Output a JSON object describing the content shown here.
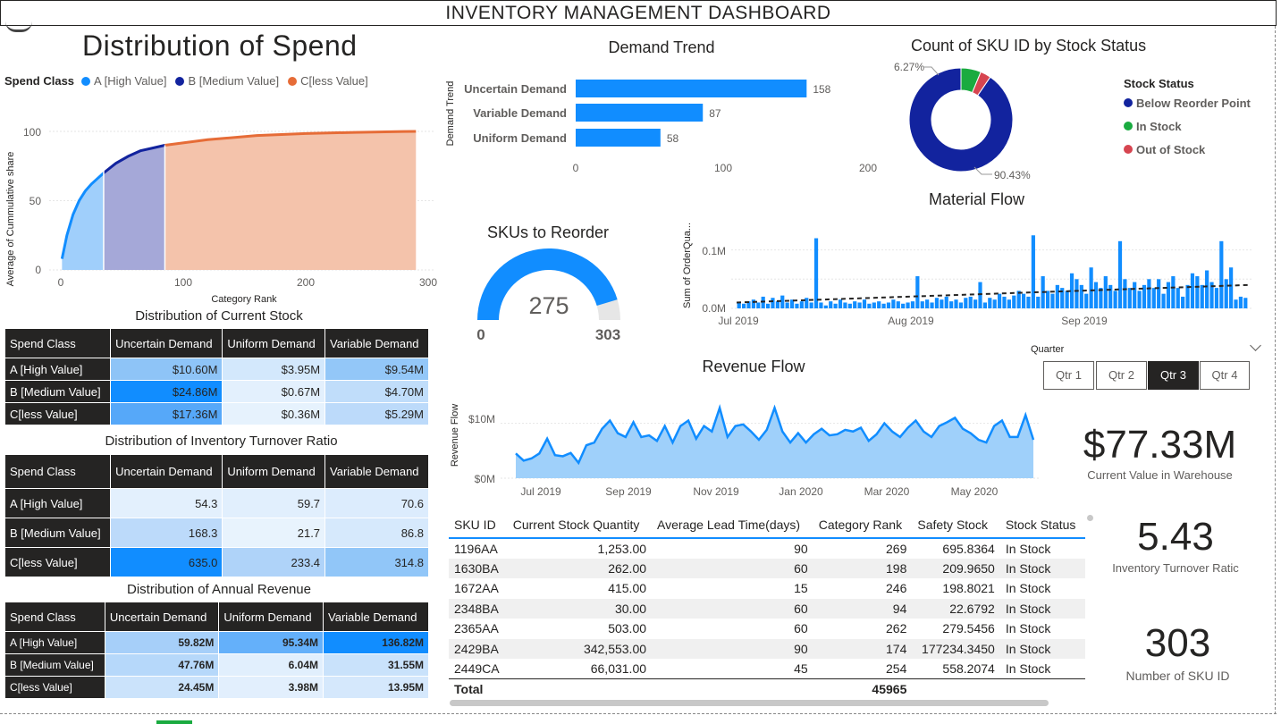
{
  "dashboard_title": "INVENTORY MANAGEMENT DASHBOARD",
  "colors": {
    "blue": "#118dff",
    "dark_navy": "#12239e",
    "orange": "#e66c37",
    "green": "#1aab40",
    "red": "#d64550",
    "dark": "#252423"
  },
  "spend_chart": {
    "title": "Distribution of Spend",
    "legend_title": "Spend Class",
    "legend": [
      {
        "label": "A [High Value]",
        "color": "#118dff"
      },
      {
        "label": "B [Medium Value]",
        "color": "#12239e"
      },
      {
        "label": "C[less Value]",
        "color": "#e66c37"
      }
    ],
    "xlabel": "Category Rank",
    "ylabel": "Average of Cummulative share",
    "x_ticks": [
      "0",
      "100",
      "200",
      "300"
    ],
    "y_ticks": [
      "0",
      "50",
      "100"
    ]
  },
  "current_stock": {
    "title": "Distribution of Current Stock",
    "headers": [
      "Spend Class",
      "Uncertain Demand",
      "Uniform Demand",
      "Variable Demand"
    ],
    "rows": [
      {
        "label": "A [High Value]",
        "cells": [
          "$10.60M",
          "$3.95M",
          "$9.54M"
        ]
      },
      {
        "label": "B [Medium Value]",
        "cells": [
          "$24.86M",
          "$0.67M",
          "$4.70M"
        ]
      },
      {
        "label": "C[less Value]",
        "cells": [
          "$17.36M",
          "$0.36M",
          "$5.29M"
        ]
      }
    ]
  },
  "turnover": {
    "title": "Distribution of Inventory Turnover Ratio",
    "headers": [
      "Spend Class",
      "Uncertain Demand",
      "Uniform Demand",
      "Variable Demand"
    ],
    "rows": [
      {
        "label": "A [High Value]",
        "cells": [
          "54.3",
          "59.7",
          "70.6"
        ]
      },
      {
        "label": "B [Medium Value]",
        "cells": [
          "168.3",
          "21.7",
          "86.8"
        ]
      },
      {
        "label": "C[less Value]",
        "cells": [
          "635.0",
          "233.4",
          "314.8"
        ]
      }
    ]
  },
  "annual_revenue": {
    "title": "Distribution of Annual Revenue",
    "headers": [
      "Spend Class",
      "Uncertain Demand",
      "Uniform Demand",
      "Variable Demand"
    ],
    "rows": [
      {
        "label": "A [High Value]",
        "cells": [
          "59.82M",
          "95.34M",
          "136.82M"
        ]
      },
      {
        "label": "B [Medium Value]",
        "cells": [
          "47.76M",
          "6.04M",
          "31.55M"
        ]
      },
      {
        "label": "C[less Value]",
        "cells": [
          "24.45M",
          "3.98M",
          "13.95M"
        ]
      }
    ]
  },
  "demand_trend": {
    "title": "Demand Trend",
    "ylabel": "Demand Trend",
    "x_ticks": [
      "0",
      "100",
      "200"
    ]
  },
  "stock_status": {
    "title": "Count of SKU ID by Stock Status",
    "legend_title": "Stock Status",
    "labels_pct": [
      "6.27%",
      "90.43%"
    ],
    "legend": [
      {
        "label": "Below Reorder Point",
        "color": "#12239e"
      },
      {
        "label": "In Stock",
        "color": "#1aab40"
      },
      {
        "label": "Out of Stock",
        "color": "#d64550"
      }
    ]
  },
  "gauge": {
    "title": "SKUs to Reorder",
    "value": "275",
    "min": "0",
    "max": "303",
    "fraction": 0.9076
  },
  "material_flow": {
    "title": "Material Flow",
    "ylabel": "Sum of OrderQua...",
    "y_ticks": [
      "0.0M",
      "0.1M"
    ],
    "x_ticks": [
      "Jul 2019",
      "Aug 2019",
      "Sep 2019"
    ]
  },
  "quarter_slicer": {
    "label": "Quarter",
    "options": [
      "Qtr 1",
      "Qtr 2",
      "Qtr 3",
      "Qtr 4"
    ],
    "selected": "Qtr 3"
  },
  "revenue_flow": {
    "title": "Revenue Flow",
    "ylabel": "Revenue Flow",
    "y_ticks": [
      "$0M",
      "$10M"
    ],
    "x_ticks": [
      "Jul 2019",
      "Sep 2019",
      "Nov 2019",
      "Jan 2020",
      "Mar 2020",
      "May 2020"
    ]
  },
  "kpis": {
    "warehouse_value": "$77.33M",
    "warehouse_label": "Current Value in Warehouse",
    "turnover_value": "5.43",
    "turnover_label": "Inventory Turnover Ratic",
    "sku_count": "303",
    "sku_label": "Number of SKU ID"
  },
  "sku_table": {
    "headers": [
      "SKU ID",
      "Current Stock Quantity",
      "Average Lead Time(days)",
      "Category Rank",
      "Safety Stock",
      "Stock Status"
    ],
    "rows": [
      [
        "1196AA",
        "1,253.00",
        "90",
        "269",
        "695.8364",
        "In Stock"
      ],
      [
        "1630BA",
        "262.00",
        "60",
        "198",
        "209.9650",
        "In Stock"
      ],
      [
        "1672AA",
        "415.00",
        "15",
        "246",
        "198.8021",
        "In Stock"
      ],
      [
        "2348BA",
        "30.00",
        "60",
        "94",
        "22.6792",
        "In Stock"
      ],
      [
        "2365AA",
        "503.00",
        "60",
        "262",
        "279.5456",
        "In Stock"
      ],
      [
        "2429BA",
        "342,553.00",
        "90",
        "174",
        "177234.3450",
        "In Stock"
      ],
      [
        "2449CA",
        "66,031.00",
        "45",
        "254",
        "558.2074",
        "In Stock"
      ]
    ],
    "total_label": "Total",
    "total_rank": "45965"
  },
  "chart_data": [
    {
      "type": "area",
      "title": "Distribution of Spend",
      "xlabel": "Category Rank",
      "ylabel": "Average of Cummulative share",
      "xlim": [
        0,
        300
      ],
      "ylim": [
        0,
        100
      ],
      "series": [
        {
          "name": "A [High Value]",
          "x": [
            1,
            5,
            10,
            15,
            20,
            25,
            30,
            35
          ],
          "y": [
            8,
            25,
            40,
            50,
            57,
            62,
            66,
            70
          ]
        },
        {
          "name": "B [Medium Value]",
          "x": [
            35,
            45,
            55,
            65,
            75,
            85
          ],
          "y": [
            70,
            77,
            82,
            86,
            88,
            90
          ]
        },
        {
          "name": "C[less Value]",
          "x": [
            85,
            120,
            160,
            200,
            240,
            280,
            290
          ],
          "y": [
            90,
            94,
            97,
            98.5,
            99.3,
            99.9,
            100
          ]
        }
      ]
    },
    {
      "type": "bar",
      "title": "Demand Trend",
      "ylabel": "Demand Trend",
      "categories": [
        "Uncertain Demand",
        "Variable Demand",
        "Uniform Demand"
      ],
      "values": [
        158,
        87,
        58
      ],
      "xlim": [
        0,
        200
      ]
    },
    {
      "type": "pie",
      "title": "Count of SKU ID by Stock Status",
      "categories": [
        "Below Reorder Point",
        "In Stock",
        "Out of Stock"
      ],
      "values": [
        90.43,
        6.27,
        3.3
      ]
    },
    {
      "type": "bar",
      "title": "Material Flow",
      "ylabel": "Sum of OrderQua...",
      "ylim": [
        0,
        0.13
      ],
      "x_range": [
        "Jul 2019",
        "Sep 2019"
      ],
      "values": [
        0.01,
        0.008,
        0.012,
        0.015,
        0.01,
        0.02,
        0.008,
        0.018,
        0.012,
        0.022,
        0.01,
        0.015,
        0.008,
        0.012,
        0.018,
        0.01,
        0.12,
        0.01,
        0.005,
        0.012,
        0.008,
        0.015,
        0.01,
        0.008,
        0.012,
        0.01,
        0.015,
        0.008,
        0.01,
        0.012,
        0.008,
        0.01,
        0.015,
        0.012,
        0.008,
        0.01,
        0.012,
        0.055,
        0.012,
        0.015,
        0.01,
        0.018,
        0.015,
        0.02,
        0.012,
        0.015,
        0.01,
        0.018,
        0.02,
        0.015,
        0.045,
        0.01,
        0.018,
        0.015,
        0.025,
        0.02,
        0.015,
        0.022,
        0.03,
        0.025,
        0.02,
        0.125,
        0.02,
        0.055,
        0.03,
        0.025,
        0.04,
        0.035,
        0.03,
        0.06,
        0.05,
        0.04,
        0.025,
        0.07,
        0.045,
        0.035,
        0.055,
        0.04,
        0.03,
        0.115,
        0.05,
        0.035,
        0.045,
        0.03,
        0.04,
        0.05,
        0.035,
        0.05,
        0.025,
        0.045,
        0.055,
        0.035,
        0.02,
        0.04,
        0.06,
        0.055,
        0.04,
        0.065,
        0.045,
        0.035,
        0.115,
        0.05,
        0.07,
        0.015,
        0.02,
        0.018
      ],
      "trend": [
        0.01,
        0.04
      ]
    },
    {
      "type": "area",
      "title": "Revenue Flow",
      "ylabel": "Revenue Flow",
      "ylim": [
        0,
        14
      ],
      "x_range": [
        "Jun 2019",
        "Jun 2020"
      ],
      "values": [
        4.5,
        3.2,
        3.6,
        4.5,
        7.2,
        4.2,
        4.0,
        4.6,
        2.8,
        6.0,
        6.5,
        9.0,
        10.5,
        8.2,
        7.5,
        10.2,
        7.5,
        7.8,
        6.8,
        9.5,
        6.5,
        9.5,
        10.5,
        7.2,
        9.5,
        8.5,
        12.8,
        7.5,
        9.5,
        9.8,
        8.5,
        7.0,
        8.8,
        12.8,
        8.5,
        6.5,
        8.2,
        6.5,
        8.0,
        9.0,
        7.8,
        8.0,
        8.8,
        8.5,
        9.2,
        6.8,
        8.0,
        10.0,
        8.5,
        7.5,
        9.2,
        10.5,
        8.5,
        7.5,
        9.5,
        10.2,
        11.0,
        9.0,
        8.2,
        7.0,
        6.5,
        9.5,
        10.5,
        7.5,
        7.5,
        11.5,
        7.0
      ]
    }
  ]
}
